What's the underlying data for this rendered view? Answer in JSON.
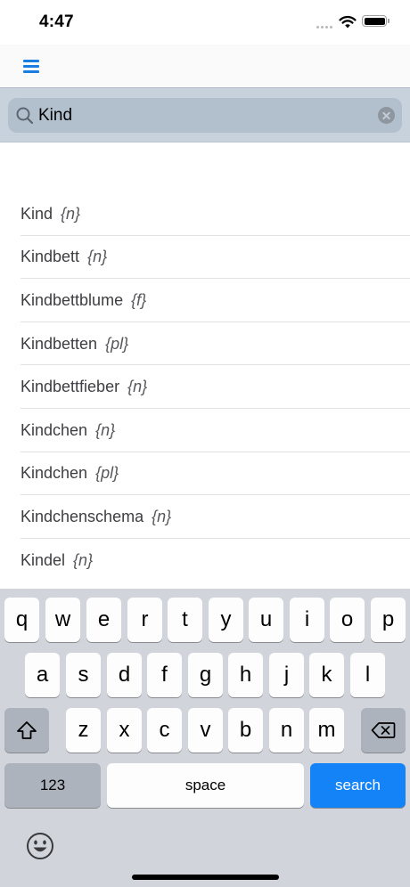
{
  "status": {
    "time": "4:47"
  },
  "nav": {
    "menu_icon": "hamburger-menu-icon",
    "accent": "#1a7de0"
  },
  "search": {
    "value": "Kind",
    "search_icon": "magnifier-icon",
    "clear_icon": "clear-circle-icon"
  },
  "results": [
    {
      "word": "Kind",
      "gender": "{n}"
    },
    {
      "word": "Kindbett",
      "gender": "{n}"
    },
    {
      "word": "Kindbettblume",
      "gender": "{f}"
    },
    {
      "word": "Kindbetten",
      "gender": "{pl}"
    },
    {
      "word": "Kindbettfieber",
      "gender": "{n}"
    },
    {
      "word": "Kindchen",
      "gender": "{n}"
    },
    {
      "word": "Kindchen",
      "gender": "{pl}"
    },
    {
      "word": "Kindchenschema",
      "gender": "{n}"
    },
    {
      "word": "Kindel",
      "gender": "{n}"
    }
  ],
  "keyboard": {
    "row1": [
      "q",
      "w",
      "e",
      "r",
      "t",
      "y",
      "u",
      "i",
      "o",
      "p"
    ],
    "row2": [
      "a",
      "s",
      "d",
      "f",
      "g",
      "h",
      "j",
      "k",
      "l"
    ],
    "row3": [
      "z",
      "x",
      "c",
      "v",
      "b",
      "n",
      "m"
    ],
    "numbers_label": "123",
    "space_label": "space",
    "search_label": "search",
    "shift_icon": "shift-icon",
    "delete_icon": "delete-backspace-icon",
    "emoji_icon": "emoji-icon",
    "action_color": "#1383f7"
  }
}
